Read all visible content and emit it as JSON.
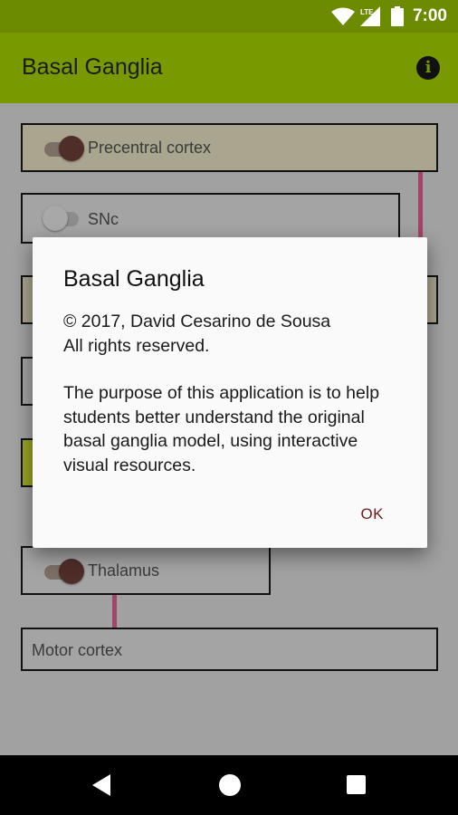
{
  "status_bar": {
    "time": "7:00",
    "network": "LTE"
  },
  "app_bar": {
    "title": "Basal Ganglia",
    "info_icon": "info-icon"
  },
  "nodes": {
    "precentral": {
      "label": "Precentral cortex",
      "toggle_on": true
    },
    "snc": {
      "label": "SNc",
      "toggle_on": false
    },
    "thalamus": {
      "label": "Thalamus",
      "toggle_on": true
    },
    "motor": {
      "label": "Motor cortex"
    }
  },
  "dialog": {
    "title": "Basal Ganglia",
    "copyright": "© 2017, David Cesarino de Sousa",
    "rights": "All rights reserved.",
    "purpose": "The purpose of this application is to help students better understand the original basal ganglia model, using interactive visual resources.",
    "ok_label": "OK"
  },
  "colors": {
    "primary": "#789a00",
    "primary_dark": "#6d8b00",
    "accent": "#6b1d1d",
    "connector": "#a3446a"
  }
}
